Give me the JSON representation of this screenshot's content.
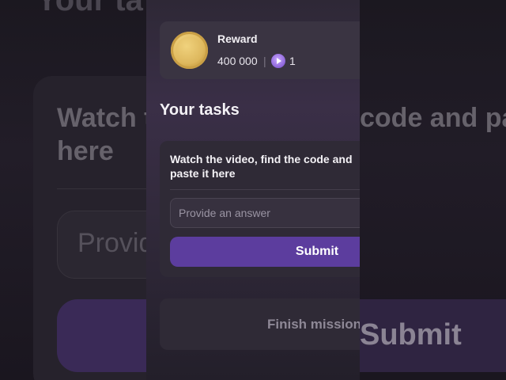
{
  "background": {
    "top_title": "Your ta",
    "task_text": "Watch th",
    "task_text_line2": "here",
    "input_placeholder": "Provid",
    "right_task_text": "code and past",
    "right_submit": "Submit"
  },
  "reward": {
    "label": "Reward",
    "amount": "400 000",
    "separator": "|",
    "gem_count": "1",
    "coin_icon": "gold-coin-icon",
    "gem_icon": "purple-play-gem-icon"
  },
  "tasks": {
    "title": "Your tasks",
    "instruction": "Watch the video, find the code and paste it here",
    "answer_placeholder": "Provide an answer",
    "answer_value": "",
    "submit_label": "Submit"
  },
  "finish": {
    "label": "Finish mission"
  },
  "colors": {
    "accent": "#5c3d9e",
    "panel": "#2f2a36",
    "text": "#f4f2f6",
    "muted": "#8e8896"
  }
}
